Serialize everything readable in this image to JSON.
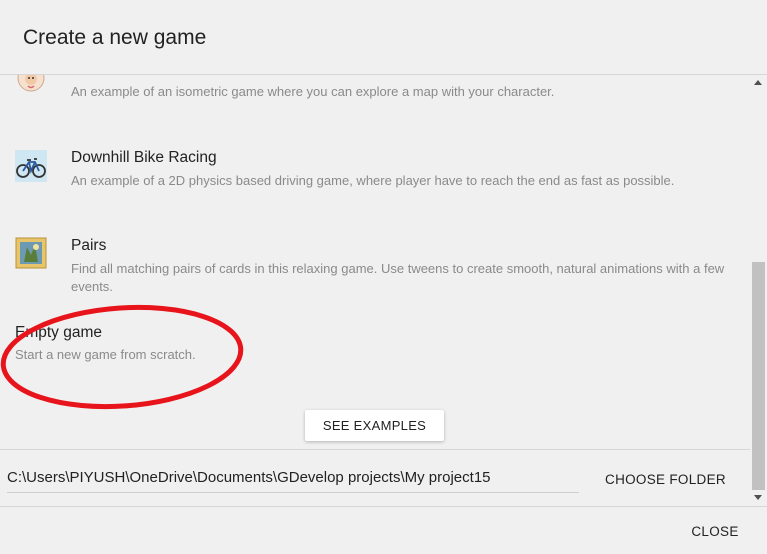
{
  "dialog": {
    "title": "Create a new game"
  },
  "examples": [
    {
      "name": "",
      "description": "An example of an isometric game where you can explore a map with your character.",
      "icon": "character-face-icon"
    },
    {
      "name": "Downhill Bike Racing",
      "description": "An example of a 2D physics based driving game, where player have to reach the end as fast as possible.",
      "icon": "bicycle-icon"
    },
    {
      "name": "Pairs",
      "description": "Find all matching pairs of cards in this relaxing game. Use tweens to create smooth, natural animations with a few events.",
      "icon": "cards-icon"
    }
  ],
  "empty_game": {
    "name": "Empty game",
    "description": "Start a new game from scratch."
  },
  "see_examples_label": "SEE EXAMPLES",
  "project_path": "C:\\Users\\PIYUSH\\OneDrive\\Documents\\GDevelop projects\\My project15",
  "choose_folder_label": "CHOOSE FOLDER",
  "close_label": "CLOSE",
  "colors": {
    "background": "#f0f0f0",
    "annotation_circle": "#e8141b",
    "secondary_text": "#8a8a8a"
  }
}
